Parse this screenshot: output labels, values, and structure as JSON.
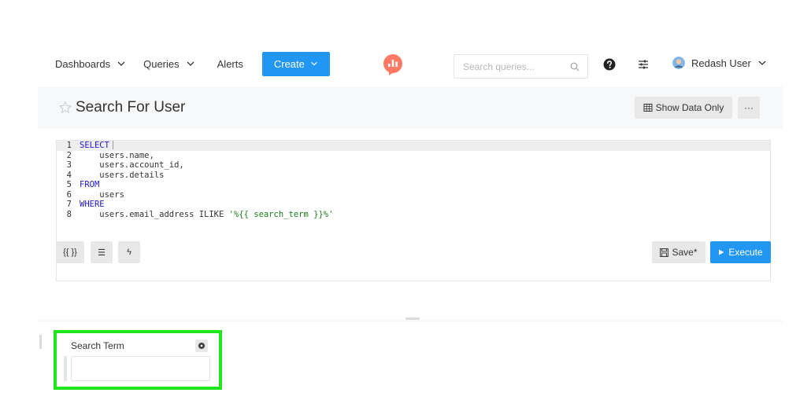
{
  "nav": {
    "dashboards": "Dashboards",
    "queries": "Queries",
    "alerts": "Alerts",
    "create": "Create",
    "search_placeholder": "Search queries...",
    "user_name": "Redash User"
  },
  "query": {
    "title": "Search For User",
    "show_data_label": "Show Data Only",
    "more_label": "···",
    "save_label": "Save*",
    "execute_label": "Execute"
  },
  "editor": {
    "lines": [
      {
        "no": "1",
        "kw": "SELECT",
        "code": ""
      },
      {
        "no": "2",
        "kw": "",
        "code": "    users.name,"
      },
      {
        "no": "3",
        "kw": "",
        "code": "    users.account_id,"
      },
      {
        "no": "4",
        "kw": "",
        "code": "    users.details"
      },
      {
        "no": "5",
        "kw": "FROM",
        "code": ""
      },
      {
        "no": "6",
        "kw": "",
        "code": "    users"
      },
      {
        "no": "7",
        "kw": "WHERE",
        "code": ""
      },
      {
        "no": "8",
        "kw": "",
        "code": "    users.email_address ILIKE ",
        "str": "'%{{ search_term }}%'"
      }
    ]
  },
  "toolbar": {
    "params_label": "{{ }}",
    "format_label": "☰",
    "autocomplete_label": "ϟ"
  },
  "params": {
    "label": "Search Term",
    "value": ""
  },
  "colors": {
    "primary": "#2196f3",
    "highlight": "#22e61c",
    "keyword": "#1f18c7",
    "string": "#1a7d1a"
  },
  "icons": [
    "chevron-down-icon",
    "logo-icon",
    "search-icon",
    "help-icon",
    "settings-icon",
    "avatar",
    "star-icon",
    "table-icon",
    "save-icon",
    "play-icon",
    "gear-icon"
  ]
}
